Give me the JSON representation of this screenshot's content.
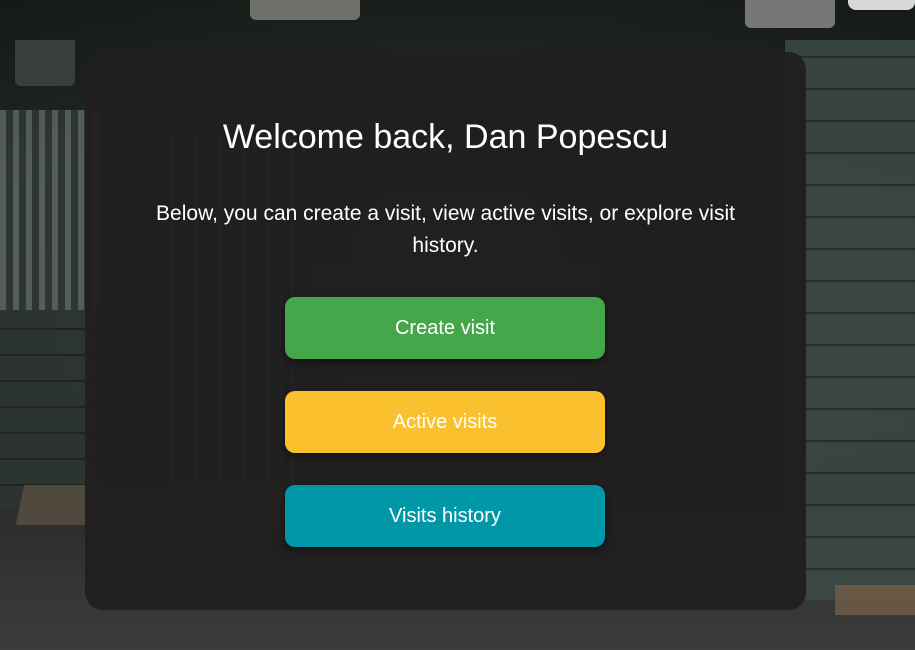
{
  "welcome": {
    "title": "Welcome back, Dan Popescu",
    "subtitle": "Below, you can create a visit, view active visits, or explore visit history."
  },
  "actions": {
    "create_label": "Create visit",
    "active_label": "Active visits",
    "history_label": "Visits history"
  },
  "colors": {
    "create": "#45a64a",
    "active": "#fbc02d",
    "history": "#0097a7",
    "card": "#201e1e"
  }
}
